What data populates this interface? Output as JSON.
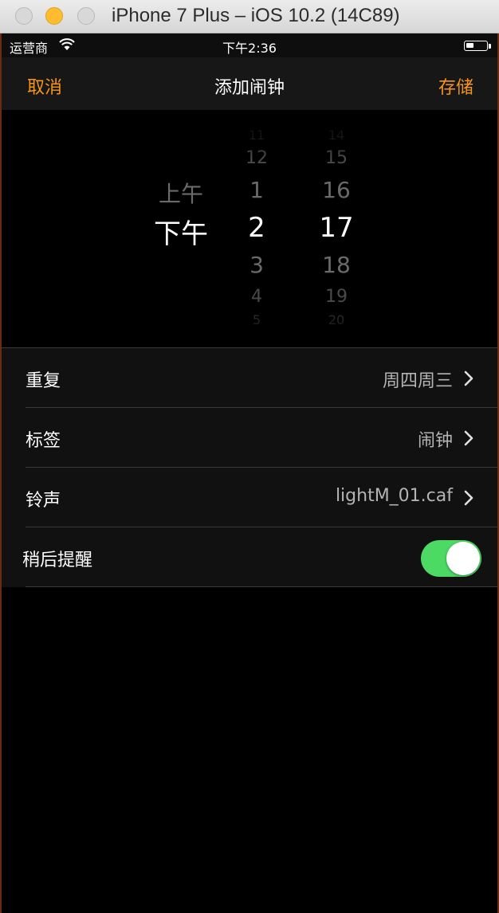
{
  "window": {
    "title": "iPhone 7 Plus – iOS 10.2 (14C89)"
  },
  "status_bar": {
    "carrier": "运营商",
    "time": "下午2:36",
    "wifi_icon": "wifi-icon",
    "battery_icon": "battery-icon"
  },
  "nav": {
    "cancel": "取消",
    "title": "添加闹钟",
    "save": "存储",
    "accent_color": "#f7941d"
  },
  "picker": {
    "ampm": [
      "上午",
      "下午"
    ],
    "ampm_selected": "下午",
    "hours": [
      "11",
      "12",
      "1",
      "2",
      "3",
      "4",
      "5"
    ],
    "hour_selected": "2",
    "minutes": [
      "14",
      "15",
      "16",
      "17",
      "18",
      "19",
      "20"
    ],
    "minute_selected": "17"
  },
  "settings": [
    {
      "label": "重复",
      "value": "周四周三"
    },
    {
      "label": "标签",
      "value": "闹钟"
    },
    {
      "label": "铃声",
      "value": "lightM_01.caf"
    }
  ],
  "snooze": {
    "label": "稍后提醒",
    "enabled": true,
    "toggle_color": "#4cd964"
  }
}
